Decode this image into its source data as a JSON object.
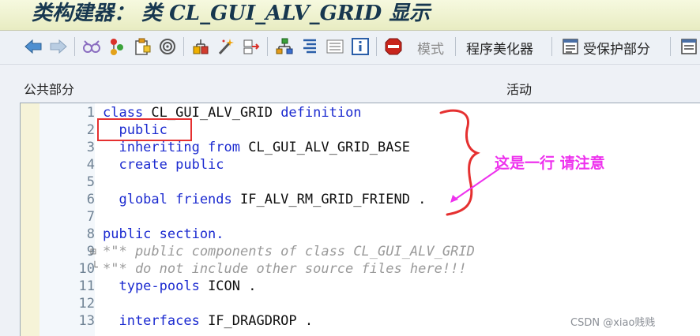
{
  "title": "类构建器： 类 CL_GUI_ALV_GRID 显示",
  "toolbar": {
    "icons": [
      "back-arrow-icon",
      "forward-arrow-icon",
      "glasses-icon",
      "object-tree-icon",
      "clipboard-icon",
      "where-used-icon",
      "hierarchy-icon",
      "magic-wand-icon",
      "transport-icon",
      "class-hierarchy-icon",
      "pretty-print-icon",
      "list-icon",
      "info-icon",
      "stop-icon"
    ],
    "mode_label": "模式",
    "pretty_printer_label": "程序美化器",
    "protected_section_label": "受保护部分"
  },
  "section_header": {
    "left": "公共部分",
    "right": "活动"
  },
  "editor": {
    "line_numbers": [
      "1",
      "2",
      "3",
      "4",
      "5",
      "6",
      "7",
      "8",
      "9",
      "10",
      "11",
      "12",
      "13"
    ],
    "lines": [
      {
        "parts": [
          {
            "t": "class ",
            "c": "kw"
          },
          {
            "t": "CL_GUI_ALV_GRID ",
            "c": "id"
          },
          {
            "t": "definition",
            "c": "kw"
          }
        ]
      },
      {
        "parts": [
          {
            "t": "  public",
            "c": "kw"
          }
        ]
      },
      {
        "parts": [
          {
            "t": "  inheriting from ",
            "c": "kw"
          },
          {
            "t": "CL_GUI_ALV_GRID_BASE",
            "c": "id"
          }
        ]
      },
      {
        "parts": [
          {
            "t": "  create public",
            "c": "kw"
          }
        ]
      },
      {
        "parts": [
          {
            "t": "",
            "c": "id"
          }
        ]
      },
      {
        "parts": [
          {
            "t": "  global friends ",
            "c": "kw"
          },
          {
            "t": "IF_ALV_RM_GRID_FRIEND .",
            "c": "id"
          }
        ]
      },
      {
        "parts": [
          {
            "t": "",
            "c": "id"
          }
        ]
      },
      {
        "parts": [
          {
            "t": "public section.",
            "c": "kw"
          }
        ]
      },
      {
        "parts": [
          {
            "t": "*\"* public components of class CL_GUI_ALV_GRID",
            "c": "cm"
          }
        ]
      },
      {
        "parts": [
          {
            "t": "*\"* do not include other source files here!!!",
            "c": "cm"
          }
        ]
      },
      {
        "parts": [
          {
            "t": "  type-pools ",
            "c": "kw"
          },
          {
            "t": "ICON .",
            "c": "id"
          }
        ]
      },
      {
        "parts": [
          {
            "t": "",
            "c": "id"
          }
        ]
      },
      {
        "parts": [
          {
            "t": "  interfaces ",
            "c": "kw"
          },
          {
            "t": "IF_DRAGDROP .",
            "c": "id"
          }
        ]
      }
    ]
  },
  "annotation": "这是一行 请注意",
  "watermark": "CSDN @xiao贱贱",
  "colors": {
    "keyword": "#1b2ad0",
    "comment": "#9a9a9a",
    "annotation": "#ee32ee",
    "highlight_box": "#e53030"
  }
}
